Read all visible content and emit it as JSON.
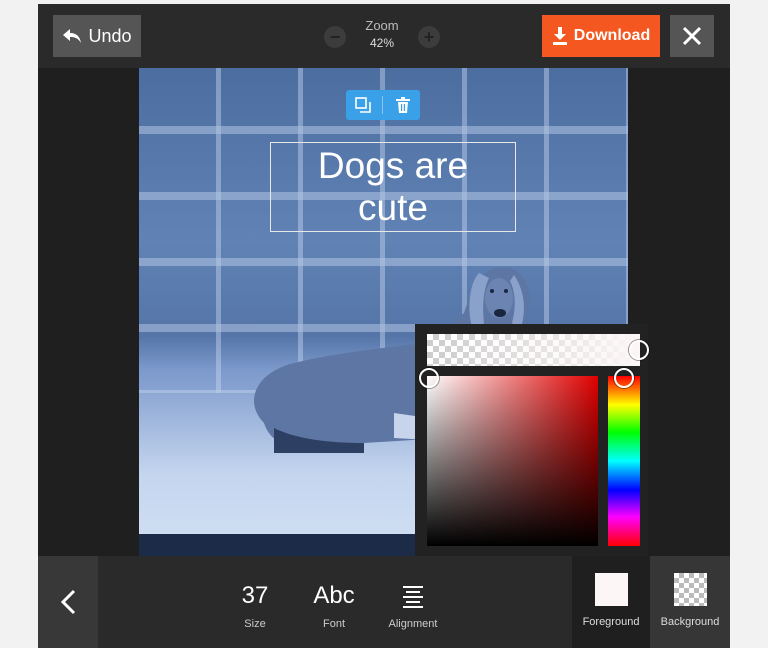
{
  "topbar": {
    "undo_label": "Undo",
    "zoom_label": "Zoom",
    "zoom_value": "42%",
    "zoom_minus": "−",
    "zoom_plus": "+",
    "download_label": "Download"
  },
  "canvas": {
    "text_content": "Dogs are\ncute",
    "icons": {
      "duplicate": "duplicate-icon",
      "delete": "trash-icon"
    }
  },
  "color_picker": {
    "foreground_color": "#fcf6f6",
    "hue": "#ff0000"
  },
  "bottombar": {
    "size_value": "37",
    "size_label": "Size",
    "font_value": "Abc",
    "font_label": "Font",
    "alignment_label": "Alignment",
    "foreground_label": "Foreground",
    "background_label": "Background"
  },
  "colors": {
    "accent": "#f4571f",
    "toolbar_blue": "#3aa0e8"
  }
}
